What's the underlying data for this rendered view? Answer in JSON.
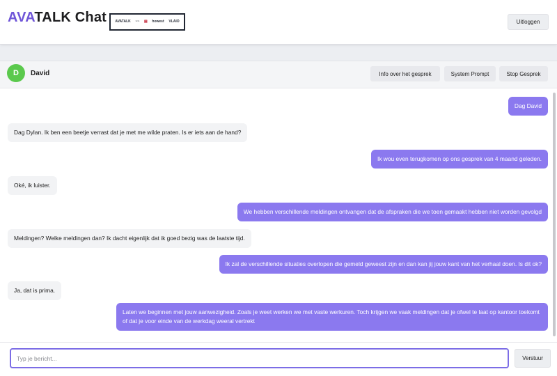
{
  "app": {
    "title_accent": "AVA",
    "title_rest": "TALK Chat",
    "logout_label": "Uitloggen",
    "partner_logos": [
      "AVATALK",
      "~~",
      "▤",
      "howest",
      "VLAIO"
    ]
  },
  "chat": {
    "contact_initial": "D",
    "contact_name": "David",
    "buttons": {
      "info": "Info over het gesprek",
      "system_prompt": "System Prompt",
      "stop": "Stop Gesprek"
    },
    "messages": [
      {
        "role": "user",
        "text": "Dag David"
      },
      {
        "role": "bot",
        "text": "Dag Dylan. Ik ben een beetje verrast dat je met me wilde praten. Is er iets aan de hand?"
      },
      {
        "role": "user",
        "text": "Ik wou even terugkomen op ons gesprek van 4 maand geleden."
      },
      {
        "role": "bot",
        "text": "Oké, ik luister."
      },
      {
        "role": "user",
        "text": "We hebben verschillende meldingen ontvangen dat de afspraken die we toen gemaakt hebben niet worden gevolgd"
      },
      {
        "role": "bot",
        "text": "Meldingen? Welke meldingen dan? Ik dacht eigenlijk dat ik goed bezig was de laatste tijd."
      },
      {
        "role": "user",
        "text": "Ik zal de verschillende situaties overlopen die gemeld geweest zijn en dan kan jij jouw kant van het verhaal doen. Is dit ok?"
      },
      {
        "role": "bot",
        "text": "Ja, dat is prima."
      },
      {
        "role": "user",
        "text": "Laten we beginnen met jouw aanwezigheid. Zoals je weet werken we met vaste werkuren. Toch krijgen we vaak meldingen dat je ofwel te laat op kantoor toekomt of dat je voor einde van de werkdag weeral vertrekt"
      }
    ]
  },
  "composer": {
    "placeholder": "Typ je bericht...",
    "value": "",
    "send_label": "Verstuur"
  },
  "colors": {
    "accent": "#6f55d8",
    "user_bubble": "#8b79ef",
    "bot_bubble": "#f2f3f5",
    "avatar": "#5bc94d"
  }
}
